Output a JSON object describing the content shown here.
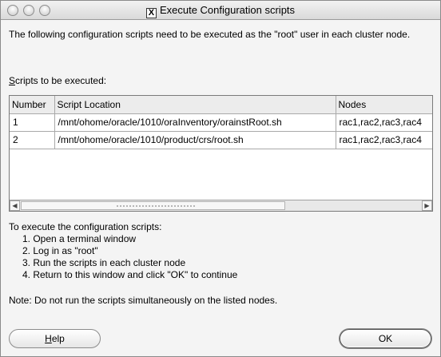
{
  "window": {
    "title": "Execute Configuration scripts"
  },
  "intro_text": "The following configuration scripts need to be executed as the \"root\" user in each cluster node.",
  "scripts_label_accel": "S",
  "scripts_label_rest": "cripts to be executed:",
  "table": {
    "columns": [
      "Number",
      "Script Location",
      "Nodes"
    ],
    "rows": [
      [
        "1",
        "/mnt/ohome/oracle/1010/oraInventory/orainstRoot.sh",
        "rac1,rac2,rac3,rac4"
      ],
      [
        "2",
        "/mnt/ohome/oracle/1010/product/crs/root.sh",
        "rac1,rac2,rac3,rac4"
      ]
    ]
  },
  "instructions": {
    "heading": "To execute the configuration scripts:",
    "steps": [
      "1. Open a terminal window",
      "2. Log in as \"root\"",
      "3. Run the scripts in each cluster node",
      "4. Return to this window and click \"OK\" to continue"
    ]
  },
  "note": "Note: Do not run the scripts simultaneously on the listed nodes.",
  "buttons": {
    "help_accel": "H",
    "help_rest": "elp",
    "ok": "OK"
  }
}
